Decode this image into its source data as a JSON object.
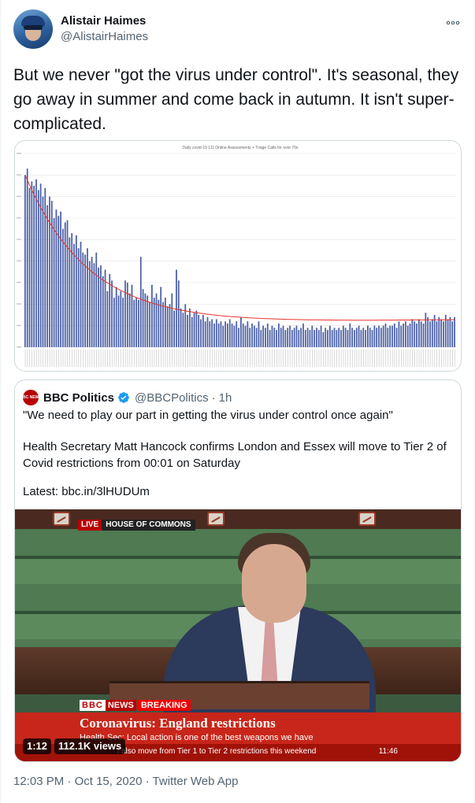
{
  "author": {
    "display_name": "Alistair Haimes",
    "handle": "@AlistairHaimes",
    "more_icon": "more-horizontal-icon"
  },
  "tweet_text": "But we never \"got the virus under control\".  It's seasonal, they go away in summer and come back in autumn. It isn't super-complicated.",
  "chart_data": {
    "type": "bar",
    "title": "Daily covid-19 111 Online Assessments + Triage Calls for over 70s",
    "series_color": "#4a5fa6",
    "trend_color": "#e8322a",
    "trend": "exponential-decay",
    "grid": true,
    "ylim": [
      0,
      9
    ],
    "values": [
      8.0,
      8.3,
      7.4,
      7.7,
      7.5,
      7.8,
      7.3,
      7.6,
      7.0,
      7.4,
      6.6,
      7.0,
      6.8,
      6.0,
      6.4,
      6.1,
      6.3,
      5.5,
      5.8,
      5.9,
      5.1,
      5.3,
      4.8,
      5.2,
      4.6,
      4.9,
      4.4,
      4.3,
      4.6,
      4.0,
      4.2,
      3.9,
      4.4,
      3.7,
      3.8,
      3.3,
      3.6,
      2.6,
      3.4,
      3.1,
      2.3,
      2.8,
      2.4,
      2.6,
      2.3,
      3.1,
      3.0,
      2.5,
      2.9,
      2.2,
      2.3,
      2.2,
      4.2,
      2.7,
      2.5,
      2.4,
      2.1,
      2.9,
      2.3,
      2.5,
      2.2,
      2.8,
      2.1,
      2.3,
      1.9,
      2.0,
      2.5,
      1.7,
      3.6,
      3.1,
      1.8,
      1.6,
      2.0,
      1.5,
      1.8,
      1.4,
      1.6,
      1.7,
      1.5,
      1.3,
      1.5,
      1.2,
      1.4,
      1.2,
      1.3,
      1.1,
      1.3,
      1.1,
      1.2,
      1.0,
      1.2,
      1.1,
      1.3,
      1.1,
      1.0,
      1.2,
      0.9,
      1.4,
      1.1,
      1.0,
      1.2,
      0.9,
      1.1,
      1.0,
      0.9,
      1.2,
      0.8,
      1.0,
      0.9,
      1.1,
      0.8,
      1.0,
      0.9,
      0.8,
      1.1,
      0.9,
      1.0,
      0.8,
      0.9,
      1.0,
      0.8,
      0.9,
      1.0,
      0.8,
      0.9,
      1.1,
      0.8,
      0.9,
      0.8,
      1.0,
      0.8,
      0.9,
      0.8,
      1.0,
      0.7,
      0.9,
      0.8,
      1.0,
      0.8,
      0.9,
      0.8,
      0.9,
      0.8,
      1.0,
      0.9,
      0.8,
      1.1,
      0.9,
      0.8,
      0.9,
      1.0,
      0.8,
      0.9,
      0.8,
      1.0,
      0.9,
      0.8,
      1.0,
      0.9,
      1.0,
      0.9,
      1.0,
      1.1,
      0.9,
      1.0,
      1.0,
      1.1,
      0.9,
      1.2,
      1.0,
      1.1,
      1.2,
      1.0,
      1.1,
      1.3,
      1.2,
      1.1,
      1.3,
      1.2,
      1.1,
      1.6,
      1.4,
      1.2,
      1.3,
      1.5,
      1.2,
      1.4,
      1.3,
      1.2,
      1.5,
      1.3,
      1.4,
      1.2,
      1.4
    ]
  },
  "quote": {
    "logo_text": "BBC NEWS",
    "name": "BBC Politics",
    "verified_icon": "verified-badge-icon",
    "handle": "@BBCPolitics",
    "separator": "·",
    "time": "1h",
    "para1": "\"We need to play our part in getting the virus under control once again\"",
    "para2": "Health Secretary Matt Hancock confirms London and Essex will move to Tier 2 of Covid restrictions from 00:01 on Saturday",
    "para3": "Latest: bbc.in/3lHUDUm",
    "video": {
      "live_label": "LIVE",
      "location_label": "HOUSE OF COMMONS",
      "brand_bbc": "BBC",
      "brand_news": "NEWS",
      "breaking_label": "BREAKING",
      "headline": "Coronavirus: England restrictions",
      "subline": "Health Sec: Local action is one of the best weapons we have",
      "ticker": "l also move from Tier 1 to Tier 2 restrictions this weekend",
      "clock": "11:46",
      "duration": "1:12",
      "views": "112.1K views"
    }
  },
  "meta": {
    "time": "12:03 PM",
    "separator1": "·",
    "date": "Oct 15, 2020",
    "separator2": "·",
    "source": "Twitter Web App"
  }
}
